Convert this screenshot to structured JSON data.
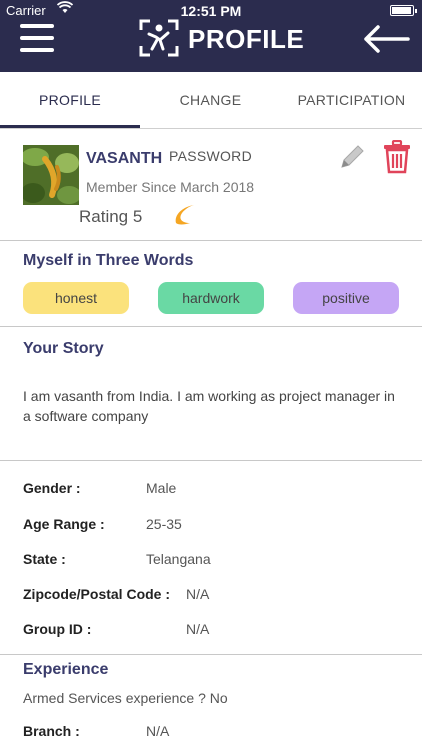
{
  "status_bar": {
    "carrier": "Carrier",
    "time": "12:51 PM"
  },
  "header": {
    "title": "PROFILE"
  },
  "tabs": [
    {
      "label": "PROFILE",
      "active": true
    },
    {
      "label": "CHANGE PASSWORD",
      "active": false
    },
    {
      "label": "PARTICIPATION",
      "active": false
    }
  ],
  "profile": {
    "name": "VASANTH",
    "member_since": "Member Since March 2018",
    "rating": "Rating 5"
  },
  "three_words": {
    "title": "Myself in Three Words",
    "chips": [
      {
        "label": "honest",
        "color": "#fbe27c"
      },
      {
        "label": "hardwork",
        "color": "#6ad9a4"
      },
      {
        "label": "positive",
        "color": "#c5a6f5"
      }
    ]
  },
  "story": {
    "title": "Your Story",
    "text": "I am vasanth from India. I am working as project manager in a software company"
  },
  "details": [
    {
      "label": "Gender :",
      "value": "Male"
    },
    {
      "label": "Age Range :",
      "value": "25-35"
    },
    {
      "label": "State :",
      "value": "Telangana"
    },
    {
      "label": "Zipcode/Postal Code :",
      "value": "N/A"
    },
    {
      "label": "Group ID :",
      "value": "N/A"
    }
  ],
  "experience": {
    "title": "Experience",
    "armed_services": "Armed Services experience ? No",
    "branch_label": "Branch :",
    "branch_value": "N/A"
  },
  "colors": {
    "navbar": "#2b2c4e",
    "accent": "#3a3c6c",
    "delete": "#e0445a",
    "rating": "#f5a623"
  }
}
